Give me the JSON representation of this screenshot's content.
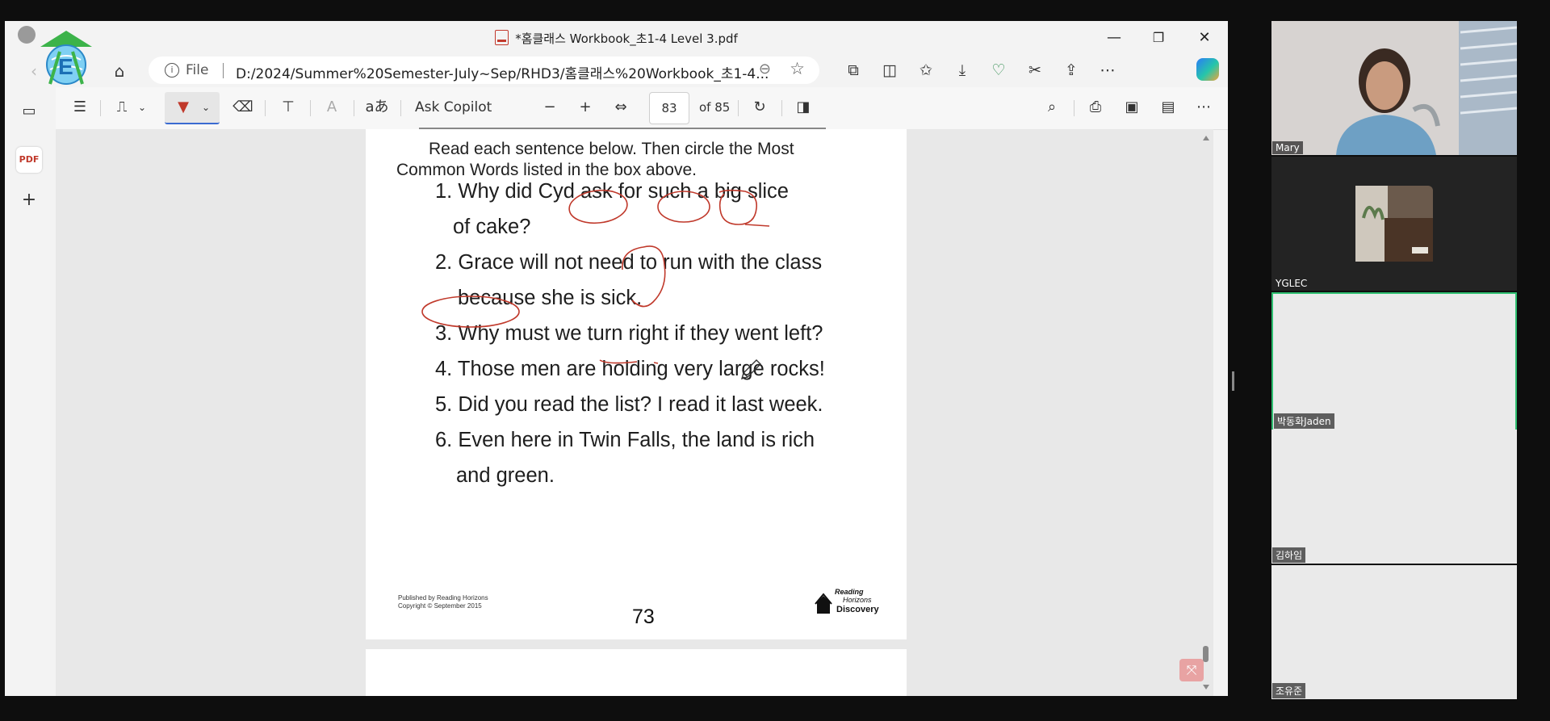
{
  "window": {
    "title": "*홈클래스 Workbook_초1-4 Level 3.pdf",
    "controls": {
      "minimize": "—",
      "restore": "❐",
      "close": "✕"
    }
  },
  "address_bar": {
    "scheme": "File",
    "url": "D:/2024/Summer%20Semester-July~Sep/RHD3/홈클래스%20Workbook_초1-4..."
  },
  "pdf_toolbar": {
    "ask_copilot": "Ask Copilot",
    "current_page": "83",
    "page_total": "of 85"
  },
  "document": {
    "instruction_line1": "Read each sentence below. Then circle the Most",
    "instruction_line2": "Common Words listed in the box above.",
    "sentences": [
      {
        "num": "1.",
        "line1": "Why did Cyd ask for such a big slice",
        "line2": "of cake?"
      },
      {
        "num": "2.",
        "line1": "Grace will not need to run with the class",
        "line2": "because she is sick."
      },
      {
        "num": "3.",
        "line1": "Why must we turn right if they went left?"
      },
      {
        "num": "4.",
        "line1": "Those men are holding very large rocks!"
      },
      {
        "num": "5.",
        "line1": "Did you read the list? I read it last week."
      },
      {
        "num": "6.",
        "line1": "Even here in Twin Falls, the land is rich",
        "line2": "and green."
      }
    ],
    "publisher_line1": "Published by Reading Horizons",
    "publisher_line2": "Copyright © September 2015",
    "logo_text_1": "Reading",
    "logo_text_2": "Horizons",
    "logo_text_3": "Discovery",
    "page_number": "73"
  },
  "participants": [
    {
      "name": "Mary"
    },
    {
      "name": "YGLEC"
    },
    {
      "name": "박동화Jaden"
    },
    {
      "name": "김하임"
    },
    {
      "name": "조유준"
    }
  ],
  "colors": {
    "annotation_ink": "#c0392b",
    "active_speaker_border": "#2fbf71"
  }
}
